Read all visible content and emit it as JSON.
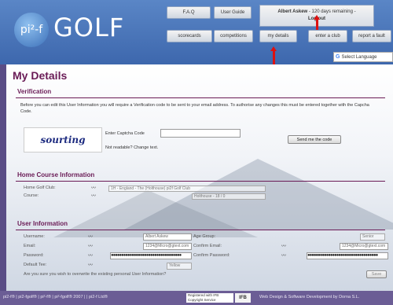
{
  "header": {
    "logo_pi": "pi²-f",
    "logo_golf": "GOLF",
    "nav": {
      "faq": "F.A.Q",
      "user_guide": "User Guide",
      "scorecards": "scorecards",
      "competitions": "competitions",
      "my_details": "my details",
      "enter_club": "enter a club",
      "report_fault": "report a fault"
    },
    "user": {
      "name": "Albert Askew",
      "remaining": "- 120 days remaining -",
      "logout": "Log out"
    },
    "language": "Select Language"
  },
  "page": {
    "title": "My Details",
    "verification": {
      "heading": "Verification",
      "text": "Before you can edit this User Information you will require a Verification code to be sent to your email address. To authorise any changes this must be entered together with the Capcha Code.",
      "captcha_image_text": "sourting",
      "captcha_label": "Enter Captcha Code",
      "captcha_value": "",
      "not_readable": "Not readable? Change text.",
      "send_button": "Send me the code"
    },
    "home_course": {
      "heading": "Home Course Information",
      "golf_club_label": "Home Golf Club:",
      "golf_club_value": "1H - England - The (Holthouse) pi2f Golf Club",
      "course_label": "Course:",
      "course_value": "Holthouse - 18 / 0"
    },
    "user_info": {
      "heading": "User Information",
      "username_label": "Username:",
      "username_value": "Albert Askew",
      "age_group_label": "Age Group:",
      "age_group_value": "Senior",
      "email_label": "Email:",
      "email_value": "1234@Micro@gtext.com",
      "confirm_email_label": "Confirm Email:",
      "confirm_email_value": "1234@Micro@gtext.com",
      "password_label": "Password:",
      "password_value": "●●●●●●●●●●●●●●●●●●●●●●●●●●●●●●●●●●",
      "confirm_password_label": "Confirm Password:",
      "confirm_password_value": "●●●●●●●●●●●●●●●●●●●●●●●●●●●●●●●●●●",
      "default_tee_label": "Default Tee:",
      "default_tee_value": "Yellow",
      "overwrite_question": "Are you sure you wish to overwrite the existing personal User Information?",
      "save_button": "Save",
      "verify_glyph": "〰"
    }
  },
  "footer": {
    "left_text": "pi2-f® | pi2-fgolf® | pi²-f® | pi²-fgolf® 2007 | | pi2-f Ltd®",
    "badge1": "Registered with IFB Copyright Service",
    "badge2": "IFB",
    "right_text": "Web Design & Software Development by Dorna S.L."
  },
  "colors": {
    "accent": "#6a1b56",
    "header_blue": "#4a78bd",
    "footer_purple": "#6b5d95",
    "arrow_red": "#dd1111"
  }
}
